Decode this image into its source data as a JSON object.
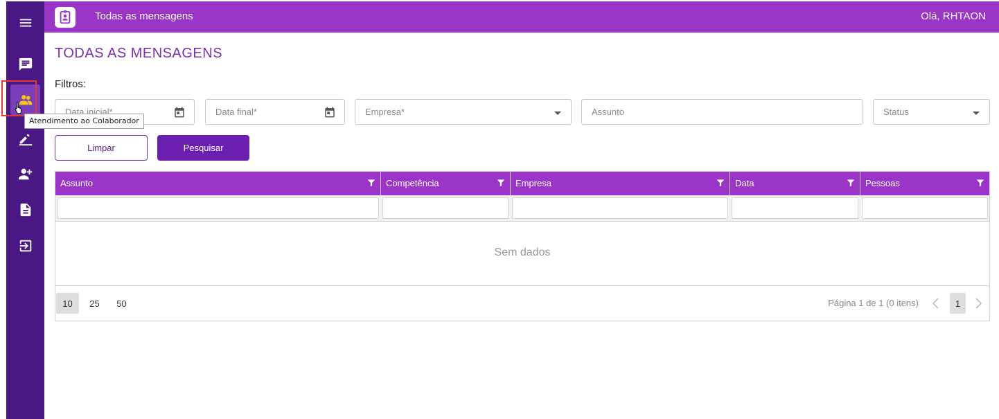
{
  "header": {
    "title": "Todas as mensagens",
    "greeting": "Olá, RHTAON"
  },
  "sidebar": {
    "items": [
      {
        "icon": "menu-icon"
      },
      {
        "icon": "message-icon"
      },
      {
        "icon": "people-icon",
        "active": true
      },
      {
        "icon": "pencil-icon"
      },
      {
        "icon": "person-add-icon"
      },
      {
        "icon": "document-icon"
      },
      {
        "icon": "logout-icon"
      }
    ],
    "tooltip": "Atendimento ao Colaborador"
  },
  "page": {
    "title": "TODAS AS MENSAGENS",
    "filters_label": "Filtros:"
  },
  "filters": {
    "data_inicial": "Data inicial*",
    "data_final": "Data final*",
    "empresa": "Empresa*",
    "assunto": "Assunto",
    "status": "Status"
  },
  "buttons": {
    "clear": "Limpar",
    "search": "Pesquisar"
  },
  "grid": {
    "columns": [
      "Assunto",
      "Competência",
      "Empresa",
      "Data",
      "Pessoas"
    ],
    "empty_text": "Sem dados",
    "page_sizes": [
      "10",
      "25",
      "50"
    ],
    "selected_page_size": "10",
    "page_info": "Página 1 de 1 (0 itens)",
    "current_page": "1"
  },
  "colors": {
    "sidebar": "#4a1885",
    "topbar": "#9a35c7",
    "accent": "#6a1fb0",
    "title": "#7b2fb5"
  }
}
